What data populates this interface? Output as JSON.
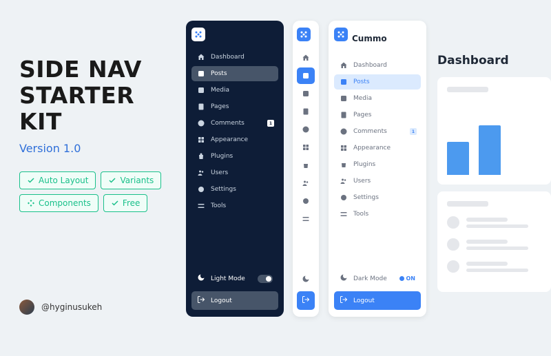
{
  "hero": {
    "title_line1": "SIDE NAV",
    "title_line2": "STARTER KIT",
    "version": "Version 1.0",
    "tags": [
      "Auto Layout",
      "Variants",
      "Components",
      "Free"
    ],
    "author": "@hyginusukeh"
  },
  "brand": {
    "name": "Cummo"
  },
  "nav": {
    "items": [
      {
        "label": "Dashboard",
        "icon": "home"
      },
      {
        "label": "Posts",
        "icon": "edit",
        "active": true
      },
      {
        "label": "Media",
        "icon": "image"
      },
      {
        "label": "Pages",
        "icon": "file"
      },
      {
        "label": "Comments",
        "icon": "chat",
        "badge": "1"
      },
      {
        "label": "Appearance",
        "icon": "grid"
      },
      {
        "label": "Plugins",
        "icon": "bag"
      },
      {
        "label": "Users",
        "icon": "users"
      },
      {
        "label": "Settings",
        "icon": "gear"
      },
      {
        "label": "Tools",
        "icon": "sliders"
      }
    ]
  },
  "mode": {
    "dark_label": "Light Mode",
    "light_label": "Dark Mode",
    "on_text": "On",
    "light_on": "ON"
  },
  "logout": {
    "label": "Logout"
  },
  "dash": {
    "title": "Dashboard"
  }
}
